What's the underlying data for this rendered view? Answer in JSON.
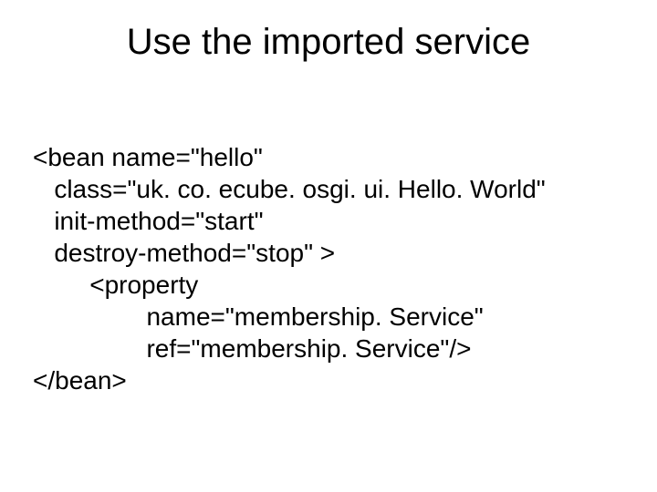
{
  "title": "Use the imported service",
  "code": {
    "l1": "<bean name=\"hello\"",
    "l2": "   class=\"uk. co. ecube. osgi. ui. Hello. World\"",
    "l3": "   init-method=\"start\"",
    "l4": "   destroy-method=\"stop\" >",
    "l5": "        <property",
    "l6": "                name=\"membership. Service\"",
    "l7": "                ref=\"membership. Service\"/>",
    "l8": "</bean>"
  }
}
